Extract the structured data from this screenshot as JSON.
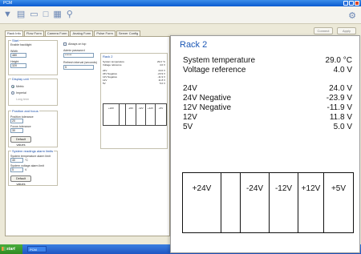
{
  "window": {
    "title": "PCM"
  },
  "toolbar": {
    "icons": [
      "filter-icon",
      "chart-icon",
      "folder-icon",
      "window-icon",
      "table-icon",
      "search-icon"
    ]
  },
  "top_buttons": {
    "left": "Connect",
    "right": "Apply"
  },
  "tabs": [
    "Rack Info",
    "Flow Form",
    "Camera Form",
    "Analog Form",
    "Pulse Form",
    "Server Config"
  ],
  "panel": {
    "start_group": {
      "title": "Start",
      "subtitle": "Enable backlight",
      "width_label": "Width",
      "width_value": "480",
      "height_label": "Height",
      "height_value": "320"
    },
    "middle": {
      "always_on_top": "Always on top",
      "password_label": "Admin password",
      "password_value": "******",
      "rotation_label": "Refresh interval (seconds)",
      "rotation_value": "5"
    },
    "display_group": {
      "title": "Display unit",
      "metric": "Metric",
      "imperial": "Imperial",
      "extra": "Long term"
    },
    "position_group": {
      "title": "Position and focus",
      "position_label": "Position tolerance",
      "position_value": "20",
      "focus_label": "Focus tolerance",
      "focus_value": "30",
      "default_button": "Default values"
    },
    "alarm_group": {
      "title": "System readings alarm limits",
      "temp_label": "System temperature alarm limit",
      "temp_value": "40",
      "temp_unit": "°C",
      "volt_label": "System voltage alarm limit",
      "volt_value": "5",
      "volt_unit": "V",
      "default_button": "Default values"
    },
    "mini_rack": {
      "title": "Rack 2",
      "rows": [
        {
          "label": "System temperature",
          "value": "29.0 °C"
        },
        {
          "label": "Voltage reference",
          "value": "4.0 V"
        },
        {
          "label": "24V",
          "value": "24.0 V"
        },
        {
          "label": "24V Negative",
          "value": "-23.9 V"
        },
        {
          "label": "12V Negative",
          "value": "-11.9 V"
        },
        {
          "label": "12V",
          "value": "11.8 V"
        },
        {
          "label": "5V",
          "value": "5.0 V"
        }
      ],
      "bars": [
        "+24V",
        "",
        "-24V",
        "-12V",
        "+12V",
        "+5V"
      ]
    }
  },
  "taskbar": {
    "start": "start",
    "item": "PCM"
  },
  "rack": {
    "title": "Rack 2",
    "readings": [
      {
        "label": "System temperature",
        "value": "29.0 °C"
      },
      {
        "label": "Voltage reference",
        "value": "4.0 V"
      }
    ],
    "voltages": [
      {
        "label": "24V",
        "value": "24.0 V"
      },
      {
        "label": "24V Negative",
        "value": "-23.9 V"
      },
      {
        "label": "12V Negative",
        "value": "-11.9 V"
      },
      {
        "label": "12V",
        "value": "11.8 V"
      },
      {
        "label": "5V",
        "value": "5.0 V"
      }
    ],
    "bar_labels": [
      "+24V",
      "",
      "-24V",
      "-12V",
      "+12V",
      "+5V"
    ]
  }
}
